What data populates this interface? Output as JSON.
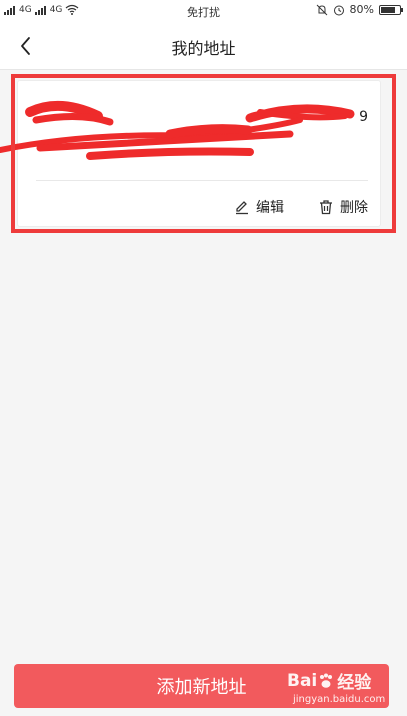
{
  "status_bar": {
    "signal_1": "4G",
    "signal_2": "4G",
    "carrier_text": "免打扰",
    "battery": "80%",
    "battery_level": 0.8
  },
  "nav": {
    "title": "我的地址",
    "back_icon": "chevron-left-icon"
  },
  "address_card": {
    "name": "",
    "phone": "9",
    "detail": "",
    "actions": {
      "edit_label": "编辑",
      "delete_label": "删除"
    }
  },
  "footer": {
    "add_label": "添加新地址"
  },
  "watermark": {
    "logo_text": "Bai",
    "logo_suffix": "经验",
    "url": "jingyan.baidu.com"
  },
  "colors": {
    "accent": "#f25a5d",
    "highlight": "#ee3b3b",
    "background": "#f5f5f5"
  }
}
